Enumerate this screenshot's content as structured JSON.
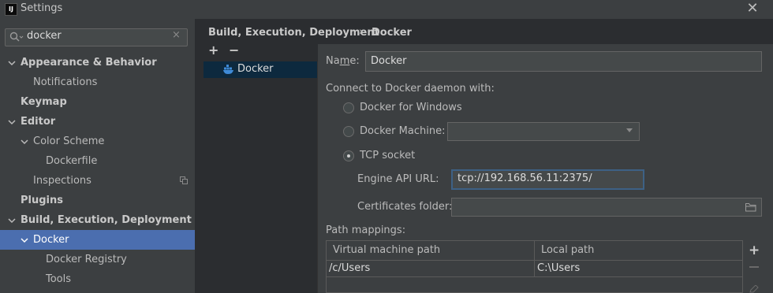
{
  "window": {
    "title": "Settings",
    "logo": "IJ"
  },
  "search": {
    "value": "docker",
    "clear_icon": "clear-icon"
  },
  "sidebar": {
    "items": [
      {
        "label": "Appearance & Behavior",
        "expanded": true
      },
      {
        "label": "Notifications"
      },
      {
        "label": "Keymap"
      },
      {
        "label": "Editor",
        "expanded": true
      },
      {
        "label": "Color Scheme",
        "expanded": true
      },
      {
        "label": "Dockerfile"
      },
      {
        "label": "Inspections"
      },
      {
        "label": "Plugins"
      },
      {
        "label": "Build, Execution, Deployment",
        "expanded": true
      },
      {
        "label": "Docker",
        "selected": true,
        "expanded": true
      },
      {
        "label": "Docker Registry"
      },
      {
        "label": "Tools"
      }
    ]
  },
  "breadcrumb": {
    "parent": "Build, Execution, Deployment",
    "separator": "›",
    "current": "Docker"
  },
  "list": {
    "add": "+",
    "remove": "−",
    "items": [
      {
        "label": "Docker",
        "icon": "docker-icon"
      }
    ]
  },
  "form": {
    "name_label_pre": "Na",
    "name_label_mnemonic": "m",
    "name_label_post": "e:",
    "name_value": "Docker",
    "connect_label": "Connect to Docker daemon with:",
    "options": [
      {
        "label": "Docker for Windows",
        "selected": false
      },
      {
        "label": "Docker Machine:",
        "selected": false
      },
      {
        "label": "TCP socket",
        "selected": true
      }
    ],
    "docker_machine_value": "",
    "engine_api_label": "Engine API URL:",
    "engine_api_value": "tcp://192.168.56.11:2375/",
    "certificates_label": "Certificates folder:",
    "certificates_value": "",
    "path_mappings_label": "Path mappings:"
  },
  "table": {
    "columns": [
      "Virtual machine path",
      "Local path"
    ],
    "rows": [
      [
        "/c/Users",
        "C:\\Users"
      ]
    ],
    "add": "+"
  },
  "colors": {
    "selection": "#4b6eaf",
    "list_selection": "#0d293e",
    "focus": "#3d6185"
  }
}
